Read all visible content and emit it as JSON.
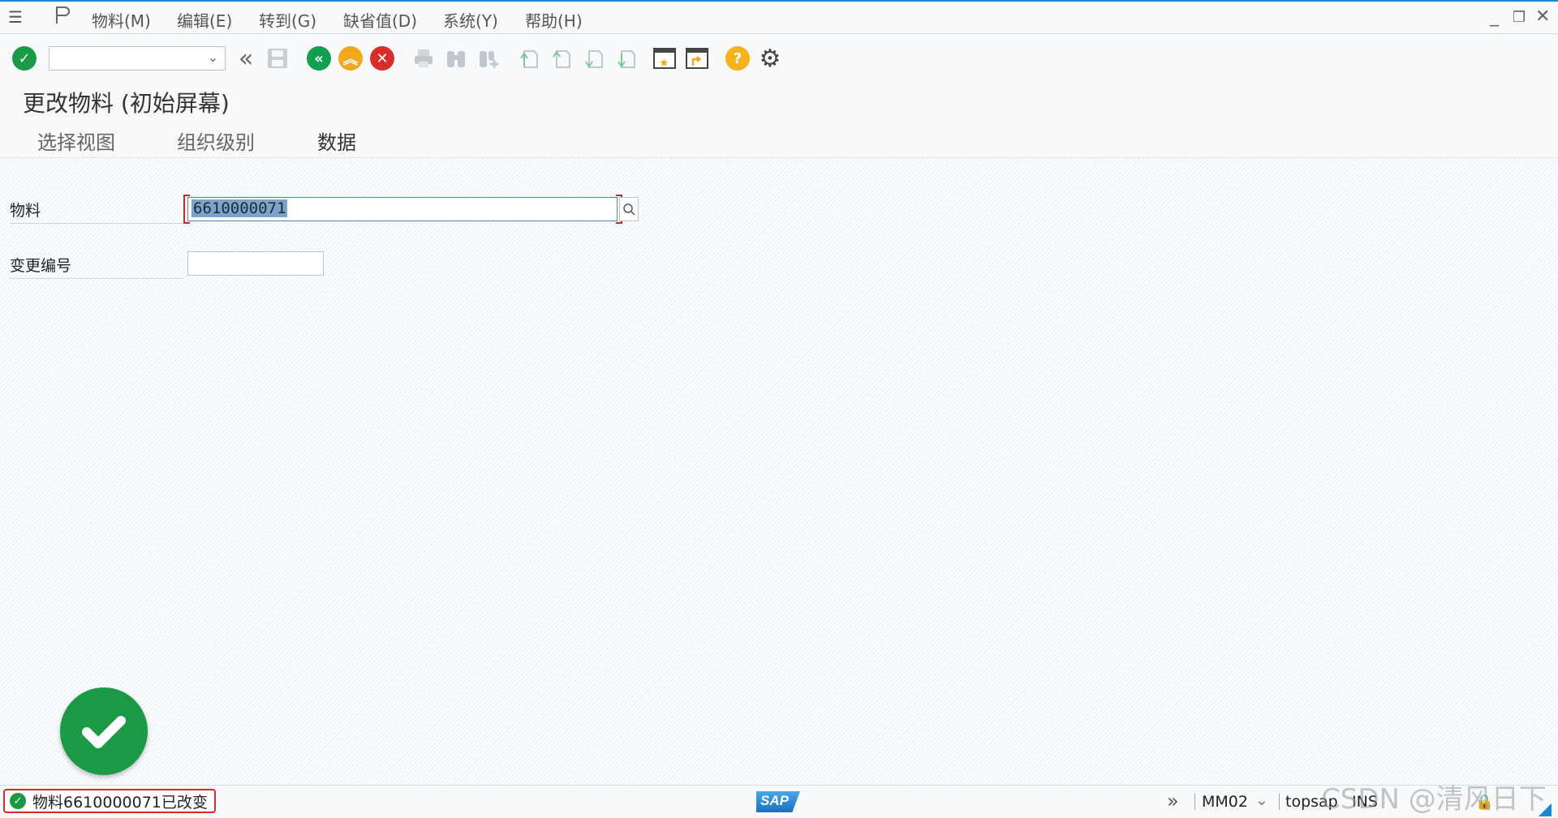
{
  "menu": {
    "items": [
      "物料(M)",
      "编辑(E)",
      "转到(G)",
      "缺省值(D)",
      "系统(Y)",
      "帮助(H)"
    ]
  },
  "window_controls": [
    "minimize-icon",
    "restore-icon",
    "close-icon"
  ],
  "toolbar": {
    "command_field_value": "",
    "icons": [
      "enter-check-icon",
      "command-dropdown",
      "collapse-double-chevron-icon",
      "save-icon",
      "back-icon",
      "exit-icon",
      "cancel-icon",
      "print-icon",
      "find-icon",
      "find-next-icon",
      "first-page-icon",
      "previous-page-icon",
      "next-page-icon",
      "last-page-icon",
      "create-session-icon",
      "generate-shortcut-icon",
      "help-icon",
      "customize-layout-icon"
    ]
  },
  "title": "更改物料 (初始屏幕)",
  "app_toolbar": {
    "buttons": [
      "选择视图",
      "组织级别",
      "数据"
    ]
  },
  "form": {
    "material_label": "物料",
    "material_value": "6610000071",
    "change_number_label": "变更编号",
    "change_number_value": ""
  },
  "status": {
    "message": "物料6610000071已改变",
    "type": "success",
    "sap_logo_text": "SAP",
    "transaction": "MM02",
    "server": "topsap",
    "mode": "INS"
  },
  "watermark": "CSDN @清风日下",
  "colors": {
    "success_green": "#1a9a45",
    "error_red": "#d22a2a",
    "back_green": "#11a050",
    "exit_orange": "#f0a81e",
    "cancel_red": "#d82c2c",
    "help_yellow": "#f5b21a",
    "accent_blue": "#1a86d0"
  }
}
